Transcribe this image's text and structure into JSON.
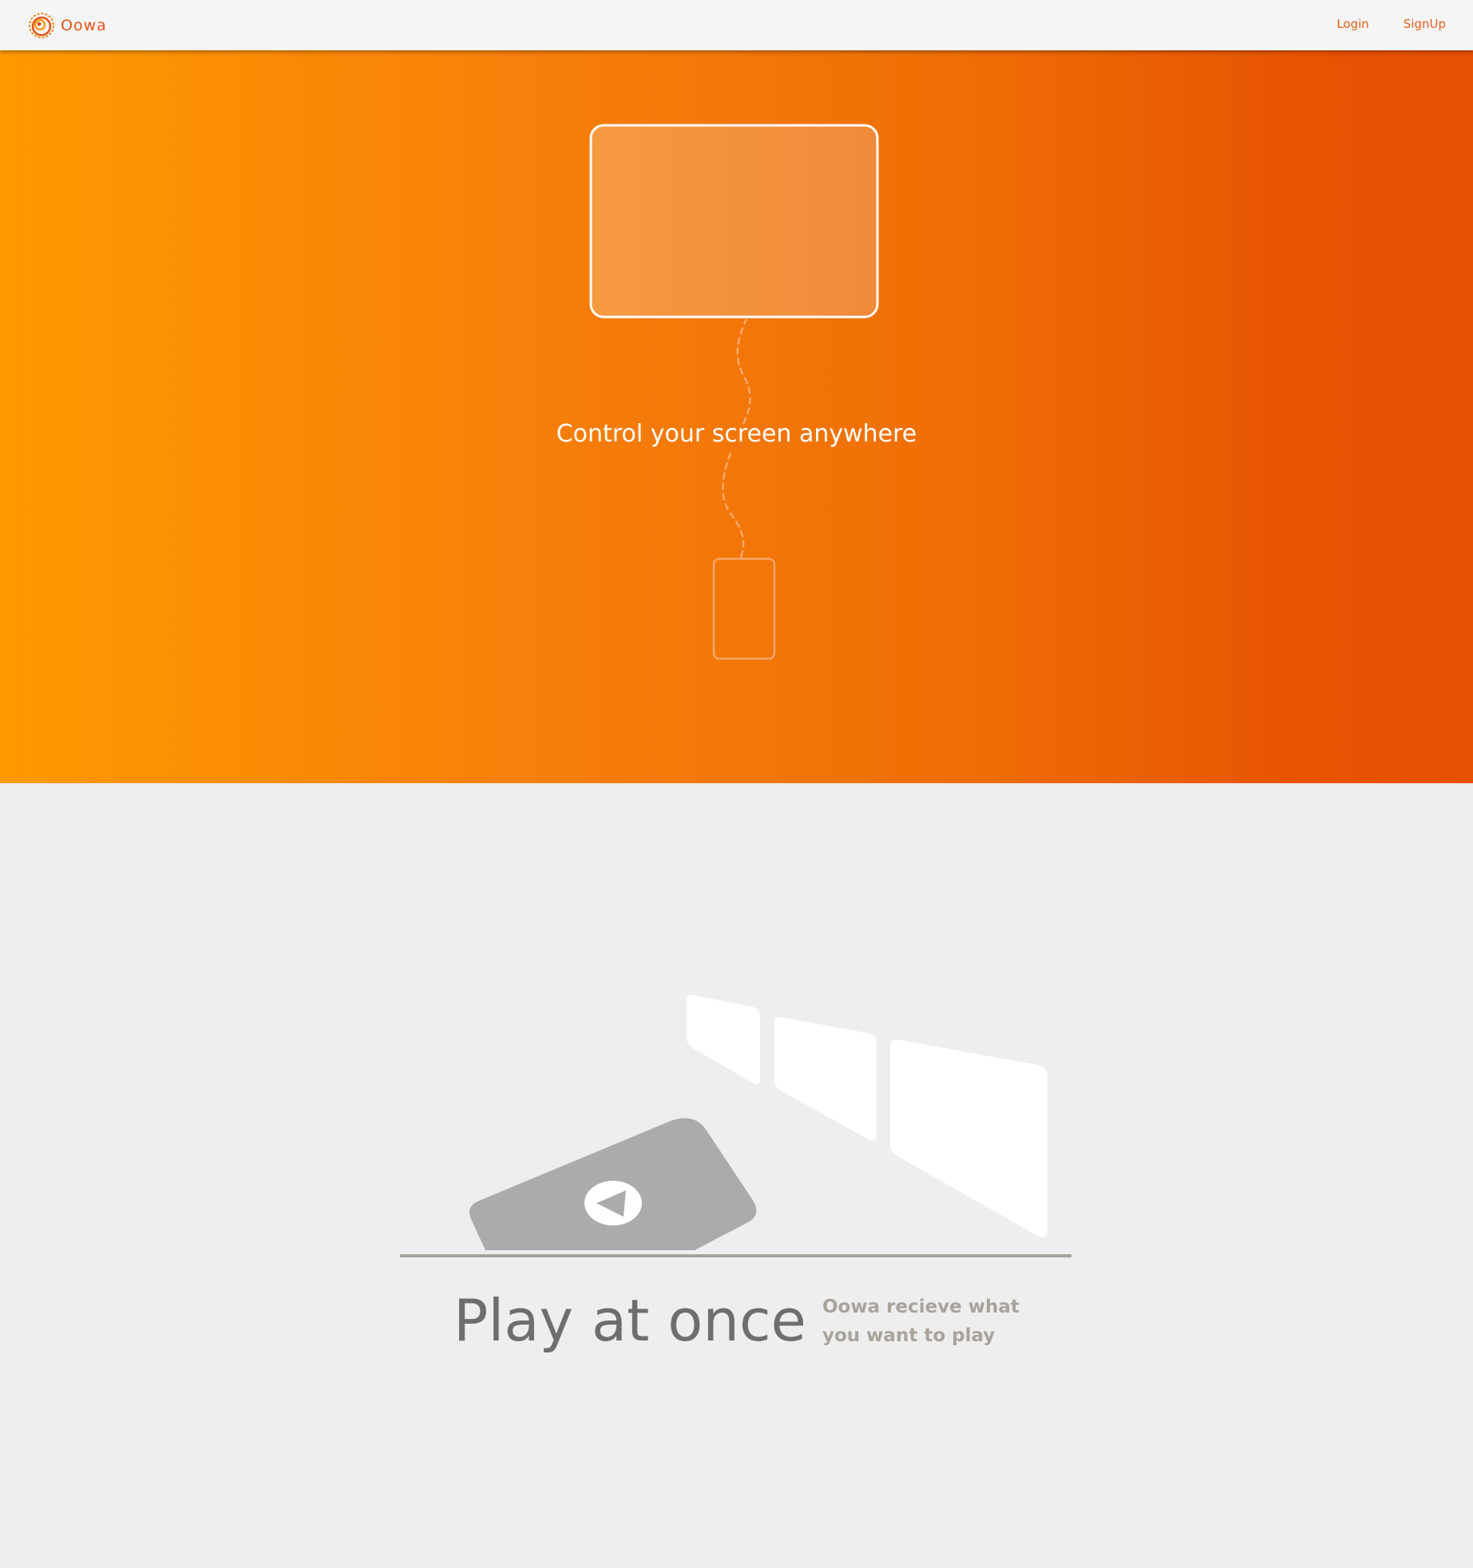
{
  "brand": {
    "name": "Oowa",
    "logo_icon": "swirl-logo-icon",
    "color": "#e8531a"
  },
  "nav": {
    "login_label": "Login",
    "signup_label": "SignUp"
  },
  "hero": {
    "tagline": "Control  your screen anywhere",
    "gradient_start": "#ff9900",
    "gradient_end": "#e55003",
    "illustration_icons": [
      "screen-icon",
      "dashed-connection-icon",
      "phone-icon"
    ]
  },
  "feature": {
    "title": "Play at once",
    "description": "Oowa recieve what you want to play",
    "illustration_icons": [
      "tilted-phone-icon",
      "play-button-icon",
      "small-screen-icon",
      "medium-screen-icon",
      "large-screen-icon",
      "baseline-icon"
    ],
    "title_color": "#6e6e6e",
    "description_color": "#a9a39c"
  }
}
